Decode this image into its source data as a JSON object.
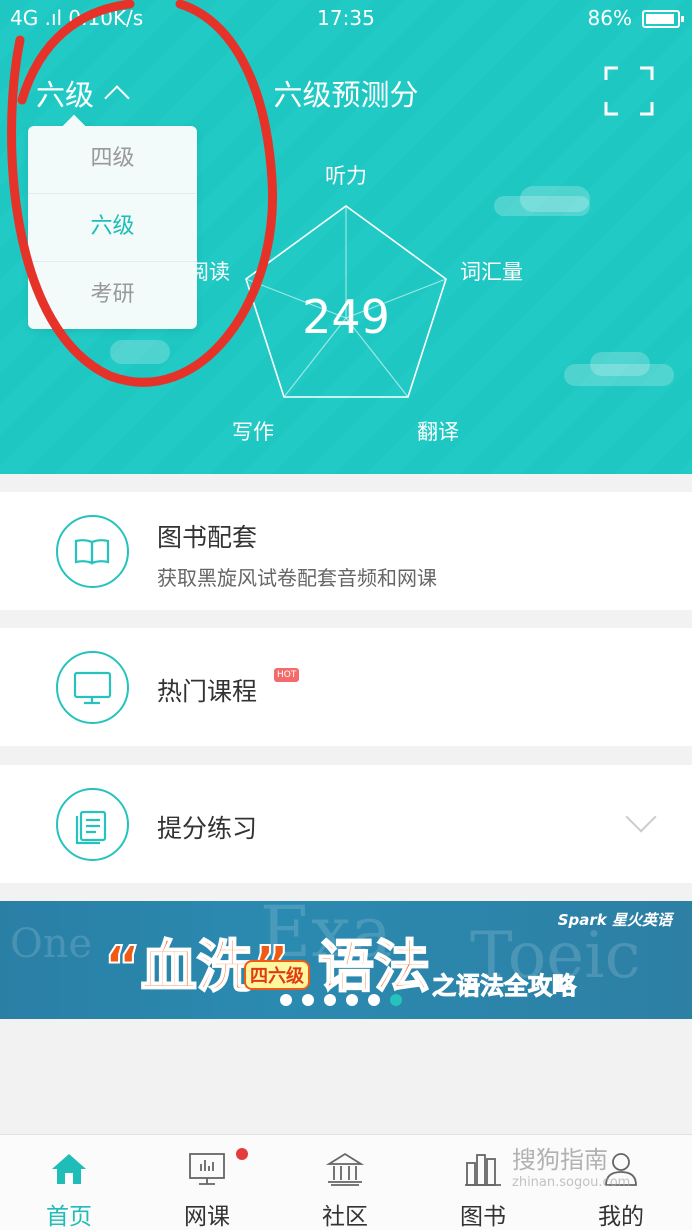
{
  "statusbar": {
    "network": "4G .ıl 0.10K/s",
    "time": "17:35",
    "battery": "86%"
  },
  "header": {
    "level": "六级",
    "title": "六级预测分"
  },
  "dropdown": {
    "options": [
      "四级",
      "六级",
      "考研"
    ],
    "selected": "六级"
  },
  "radar": {
    "score": "249",
    "axes": {
      "listening": "听力",
      "vocab": "词汇量",
      "translate": "翻译",
      "writing": "写作",
      "reading": "阅读"
    }
  },
  "cards": [
    {
      "title": "图书配套",
      "subtitle": "获取黑旋风试卷配套音频和网课"
    },
    {
      "title": "热门课程",
      "badge": "HOT"
    },
    {
      "title": "提分练习"
    }
  ],
  "banner": {
    "brand": "Spark 星火英语",
    "big1": "“血洗”",
    "badge": "四六级",
    "big2": "语法",
    "tail": "之语法全攻略",
    "dots": 6,
    "active_dot": 5
  },
  "tabs": [
    {
      "label": "首页",
      "icon": "home-icon",
      "active": true
    },
    {
      "label": "网课",
      "icon": "monitor-icon"
    },
    {
      "label": "社区",
      "icon": "temple-icon"
    },
    {
      "label": "图书",
      "icon": "books-icon"
    },
    {
      "label": "我的",
      "icon": "person-icon"
    }
  ],
  "watermark": {
    "text": "搜狗指南",
    "url": "zhinan.sogou.com"
  },
  "colors": {
    "accent": "#1ec7c2",
    "annotation": "#e5332a",
    "hot": "#f36b6b"
  }
}
